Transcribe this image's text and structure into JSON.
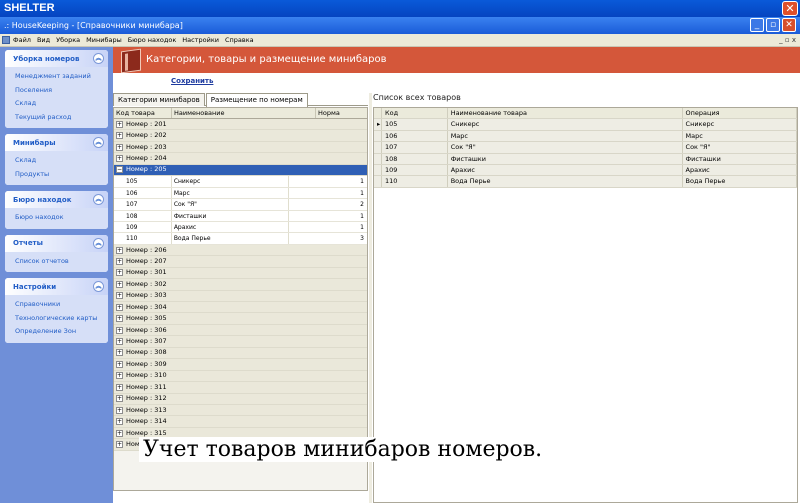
{
  "outer_title": "SHELTER",
  "inner_title": ".: HouseKeeping - [Справочники минибара]",
  "menu": [
    "Файл",
    "Вид",
    "Уборка",
    "Минибары",
    "Бюро находок",
    "Настройки",
    "Справка"
  ],
  "menu_right": "_ ▫ x",
  "sidebar": [
    {
      "title": "Уборка номеров",
      "items": [
        "Менеджмент заданий",
        "Поселения",
        "Склад",
        "Текущий расход"
      ]
    },
    {
      "title": "Минибары",
      "items": [
        "Склад",
        "Продукты"
      ]
    },
    {
      "title": "Бюро находок",
      "items": [
        "Бюро находок"
      ]
    },
    {
      "title": "Отчеты",
      "items": [
        "Список отчетов"
      ]
    },
    {
      "title": "Настройки",
      "items": [
        "Справочники",
        "Технологические карты",
        "Определение Зон"
      ]
    }
  ],
  "banner_title": "Категории, товары и размещение минибаров",
  "save_label": "Сохранить",
  "tabs": [
    "Категории минибаров",
    "Размещение по номерам"
  ],
  "left_grid": {
    "headers": [
      "Код товара",
      "Наименование",
      "Норма"
    ],
    "groups_before": [
      "Номер : 201",
      "Номер : 202",
      "Номер : 203",
      "Номер : 204"
    ],
    "expanded_group": "Номер : 205",
    "expanded_rows": [
      [
        "105",
        "Сникерс",
        "1"
      ],
      [
        "106",
        "Марс",
        "1"
      ],
      [
        "107",
        "Сок \"Я\"",
        "2"
      ],
      [
        "108",
        "Фисташки",
        "1"
      ],
      [
        "109",
        "Арахис",
        "1"
      ],
      [
        "110",
        "Вода Перье",
        "3"
      ]
    ],
    "groups_after": [
      "Номер : 206",
      "Номер : 207",
      "Номер : 301",
      "Номер : 302",
      "Номер : 303",
      "Номер : 304",
      "Номер : 305",
      "Номер : 306",
      "Номер : 307",
      "Номер : 308",
      "Номер : 309",
      "Номер : 310",
      "Номер : 311",
      "Номер : 312",
      "Номер : 313",
      "Номер : 314",
      "Номер : 315",
      "Номер : 316"
    ]
  },
  "right_panel": {
    "label": "Список всех товаров",
    "headers": [
      "Код",
      "Наименование товара",
      "Операция"
    ],
    "rows": [
      [
        "105",
        "Сникерс",
        "Сникерс"
      ],
      [
        "106",
        "Марс",
        "Марс"
      ],
      [
        "107",
        "Сок \"Я\"",
        "Сок \"Я\""
      ],
      [
        "108",
        "Фисташки",
        "Фисташки"
      ],
      [
        "109",
        "Арахис",
        "Арахис"
      ],
      [
        "110",
        "Вода Перье",
        "Вода Перье"
      ]
    ]
  },
  "caption": "Учет товаров минибаров номеров."
}
